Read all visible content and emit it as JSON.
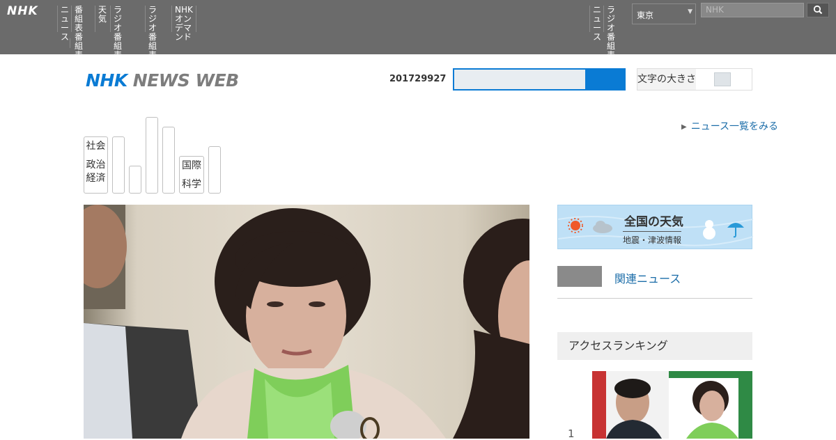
{
  "global_bar": {
    "logo": "NHK",
    "nav_items": [
      "ニュ\nース",
      "番組表\n番組表",
      "天気",
      "ラジオ\n番組表",
      "ラジオ\n番組表",
      "NHK\nオンデマ\nンド"
    ],
    "right_items": [
      "ニュ\nース",
      "ラジオ\n番組表"
    ],
    "region_select": "東京",
    "search_placeholder": "NHK"
  },
  "header": {
    "logo_nhk": "NHK",
    "logo_newsweb": "NEWS WEB",
    "date": "201729927",
    "search_value": "",
    "toggle_label": "文字の大きさ"
  },
  "tabs": [
    {
      "lines": [
        "社会",
        "政治\n経済"
      ]
    },
    {
      "lines": []
    },
    {
      "lines": []
    },
    {
      "lines": []
    },
    {
      "lines": []
    },
    {
      "lines": [
        "国際",
        "科学"
      ]
    },
    {
      "lines": []
    }
  ],
  "view_all": "ニュース一覧をみる",
  "sidebar": {
    "weather_title": "全国の天気",
    "weather_sub": "地震・津波情報",
    "related_link": "関連ニュース",
    "ranking_heading": "アクセスランキング",
    "rank_first": "1"
  },
  "colors": {
    "brand_blue": "#0a7bd4",
    "link_blue": "#1a6ca8",
    "top_bar": "#6b6b6b"
  }
}
